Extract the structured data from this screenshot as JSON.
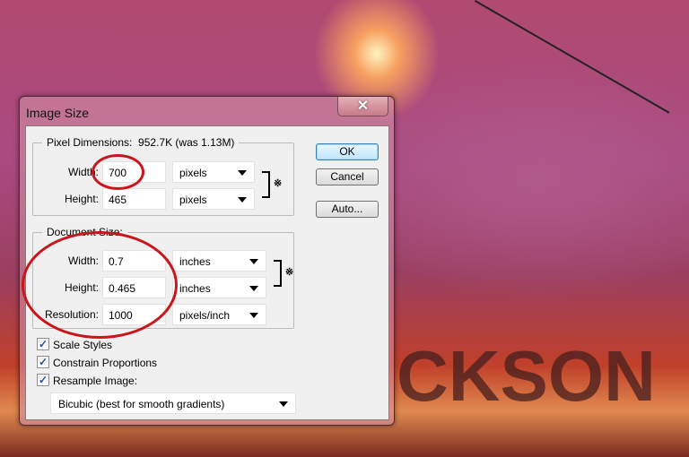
{
  "background": {
    "text": "CKSON"
  },
  "dialog": {
    "title": "Image Size",
    "close_label": "✕",
    "pixel_dimensions": {
      "legend": "Pixel Dimensions:",
      "size": "952.7K (was 1.13M)",
      "width": {
        "label": "Width:",
        "value": "700",
        "unit": "pixels"
      },
      "height": {
        "label": "Height:",
        "value": "465",
        "unit": "pixels"
      }
    },
    "document_size": {
      "legend": "Document Size:",
      "width": {
        "label": "Width:",
        "value": "0.7",
        "unit": "inches"
      },
      "height": {
        "label": "Height:",
        "value": "0.465",
        "unit": "inches"
      },
      "resolution": {
        "label": "Resolution:",
        "value": "1000",
        "unit": "pixels/inch"
      }
    },
    "buttons": {
      "ok": "OK",
      "cancel": "Cancel",
      "auto": "Auto..."
    },
    "checkboxes": [
      {
        "label": "Scale Styles",
        "checked": true
      },
      {
        "label": "Constrain Proportions",
        "checked": true
      },
      {
        "label": "Resample Image:",
        "checked": true
      }
    ],
    "resample_method": "Bicubic (best for smooth gradients)",
    "annotation_color": "#c8161b"
  }
}
